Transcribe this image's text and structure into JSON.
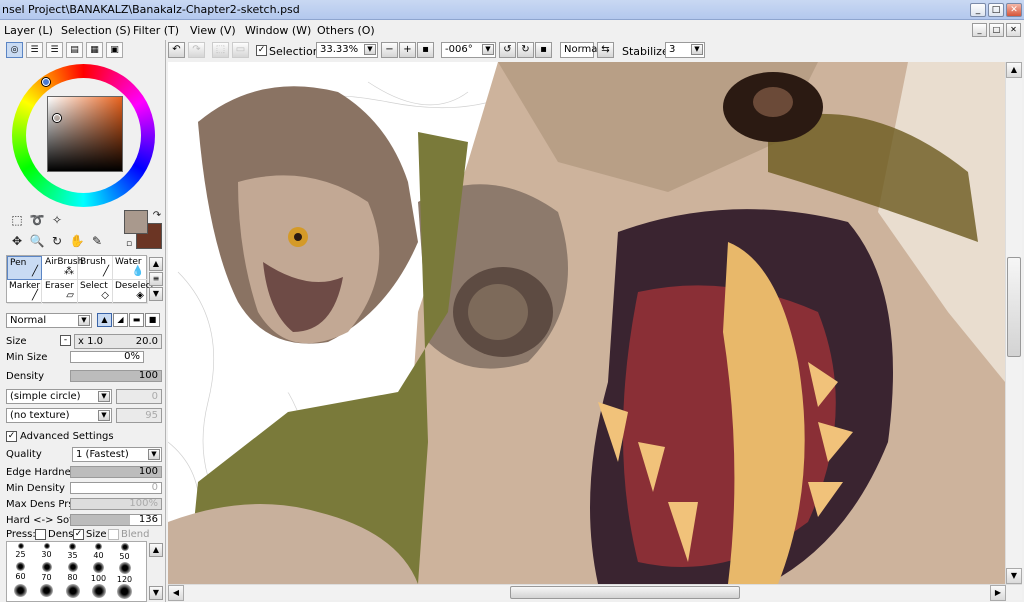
{
  "window": {
    "title": "nsel Project\\BANAKALZ\\Banakalz-Chapter2-sketch.psd",
    "buttons": [
      "_",
      "□",
      "✕"
    ]
  },
  "menubar": {
    "items": [
      "Layer (L)",
      "Selection (S)",
      "Filter (T)",
      "View (V)",
      "Window (W)",
      "Others (O)"
    ],
    "doc_buttons": [
      "_",
      "□",
      "✕"
    ]
  },
  "toolbar": {
    "selection_label": "Selection",
    "selection_checked": true,
    "zoom": "33.33%",
    "rotation": "-006°",
    "blend": "Normal",
    "stabilizer_label": "Stabilizer",
    "stabilizer_value": "3"
  },
  "tools": {
    "primary_color": "#a9998d",
    "secondary_color": "#6b3524",
    "brushes": [
      {
        "label": "Pen",
        "icon": "pen-icon",
        "selected": true
      },
      {
        "label": "AirBrush",
        "icon": "airbrush-icon",
        "selected": false
      },
      {
        "label": "Brush",
        "icon": "brush-icon",
        "selected": false
      },
      {
        "label": "Water",
        "icon": "water-icon",
        "selected": false
      },
      {
        "label": "Marker",
        "icon": "marker-icon",
        "selected": false
      },
      {
        "label": "Eraser",
        "icon": "eraser-icon",
        "selected": false
      },
      {
        "label": "Select",
        "icon": "select-icon",
        "selected": false
      },
      {
        "label": "Deselect",
        "icon": "deselect-icon",
        "selected": false
      }
    ]
  },
  "brush_settings": {
    "blend_mode": "Normal",
    "size_label": "Size",
    "size_mult": "x 1.0",
    "size_value": "20.0",
    "min_size_label": "Min Size",
    "min_size_value": "0%",
    "density_label": "Density",
    "density_value": "100",
    "shape": "(simple circle)",
    "shape_value": "0",
    "texture": "(no texture)",
    "texture_value": "95",
    "advanced_label": "Advanced Settings",
    "advanced_checked": true,
    "quality_label": "Quality",
    "quality_value": "1 (Fastest)",
    "edge_hardness_label": "Edge Hardness",
    "edge_hardness_value": "100",
    "min_density_label": "Min Density",
    "min_density_value": "0",
    "max_dens_label": "Max Dens Prs.",
    "max_dens_value": "100%",
    "hard_soft_label": "Hard <-> Soft",
    "hard_soft_value": "136",
    "press_label": "Press:",
    "press_dens_label": "Dens",
    "press_size_label": "Size",
    "press_blend_label": "Blend",
    "sizes_row1": [
      "25",
      "30",
      "35",
      "40",
      "50"
    ],
    "sizes_row2": [
      "60",
      "70",
      "80",
      "100",
      "120"
    ]
  }
}
